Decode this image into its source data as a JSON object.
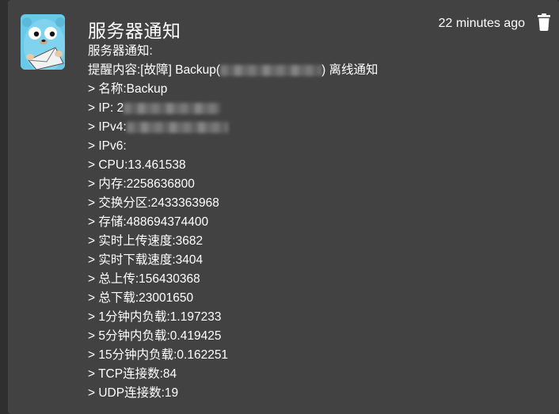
{
  "notification": {
    "title": "服务器通知",
    "time": "22 minutes ago",
    "lines": {
      "heading": "服务器通知:",
      "reminder_prefix": "提醒内容:[故障] Backup(",
      "reminder_suffix": ") 离线通知",
      "name": "> 名称:Backup",
      "ip": "> IP: 2",
      "ipv4": "> IPv4:",
      "ipv6": "> IPv6:",
      "cpu": "> CPU:13.461538",
      "memory": "> 内存:2258636800",
      "swap": "> 交换分区:2433363968",
      "storage": "> 存储:488694374400",
      "upload_speed": "> 实时上传速度:3682",
      "download_speed": "> 实时下载速度:3404",
      "total_upload": "> 总上传:156430368",
      "total_download": "> 总下载:23001650",
      "load1": "> 1分钟内负载:1.197233",
      "load5": "> 5分钟内负载:0.419425",
      "load15": "> 15分钟内负载:0.162251",
      "tcp": "> TCP连接数:84",
      "udp": "> UDP连接数:19"
    }
  },
  "icons": {
    "avatar": "gopher-mail-icon",
    "delete": "trash-icon"
  },
  "colors": {
    "background": "#2f2f2f",
    "card": "#424242",
    "text": "#ffffff",
    "avatar_bg": "#6ac9e9"
  }
}
